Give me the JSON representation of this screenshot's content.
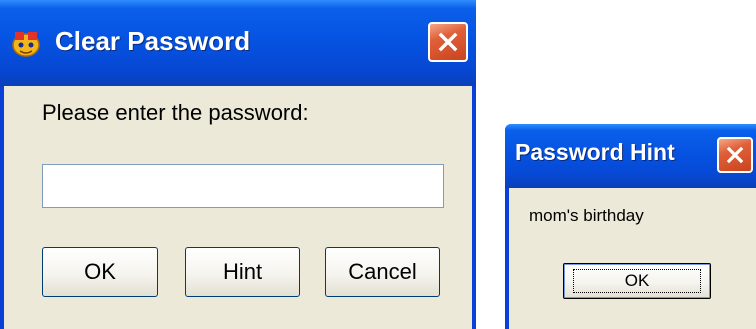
{
  "clear_password_dialog": {
    "title": "Clear Password",
    "prompt": "Please enter the password:",
    "password_value": "",
    "buttons": {
      "ok": "OK",
      "hint": "Hint",
      "cancel": "Cancel"
    },
    "icons": {
      "app": "app-icon",
      "close": "close-icon"
    }
  },
  "hint_dialog": {
    "title": "Password Hint",
    "hint_text": "mom's birthday",
    "ok_label": "OK",
    "icons": {
      "close": "close-icon"
    }
  },
  "colors": {
    "title_bar": "#0653e2",
    "client_background": "#ece9d8",
    "close_button": "#d9532f",
    "button_border": "#003c74"
  }
}
